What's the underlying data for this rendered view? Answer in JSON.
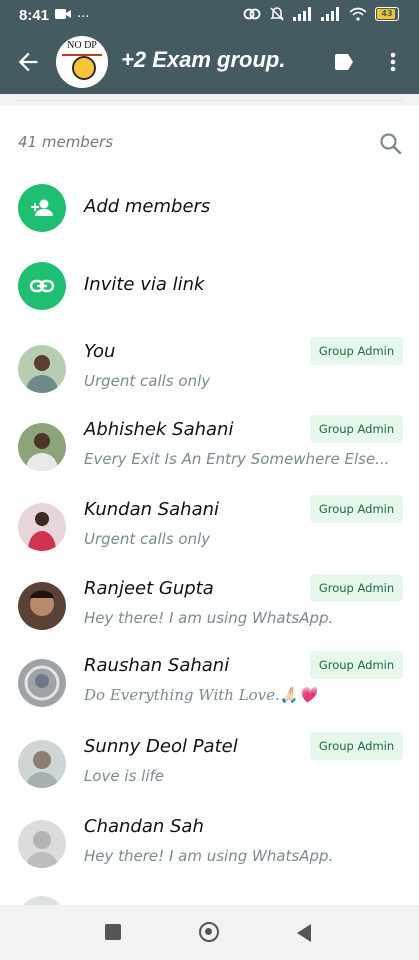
{
  "status_bar": {
    "time": "8:41",
    "battery": "43",
    "signal": "..."
  },
  "app_bar": {
    "title": "+2 Exam group.",
    "avatar_text": "NO DP",
    "bg_color": "#455b62"
  },
  "members_header": {
    "count_label": "41 members"
  },
  "actions": [
    {
      "label": "Add members",
      "icon": "person-add-icon"
    },
    {
      "label": "Invite via link",
      "icon": "link-icon"
    }
  ],
  "members": [
    {
      "name": "You",
      "status": "Urgent calls only",
      "badge": "Group Admin",
      "avatar_color": "#7aa37a"
    },
    {
      "name": "Abhishek Sahani",
      "status": "Every Exit Is An Entry Somewhere Else...",
      "badge": "Group Admin",
      "avatar_color": "#6f8a5a"
    },
    {
      "name": "Kundan Sahani",
      "status": "Urgent calls only",
      "badge": "Group Admin",
      "avatar_color": "#c2536a"
    },
    {
      "name": "Ranjeet Gupta",
      "status": "Hey there! I am using WhatsApp.",
      "badge": "Group Admin",
      "avatar_color": "#6b4b3a"
    },
    {
      "name": "Raushan Sahani",
      "status": "Do Everything With Love.🙏🏻💗",
      "badge": "Group Admin",
      "avatar_color": "#8a8f96"
    },
    {
      "name": "Sunny Deol Patel",
      "status": "Love is life",
      "badge": "Group Admin",
      "avatar_color": "#b8bfbf"
    },
    {
      "name": "Chandan Sah",
      "status": "Hey there! I am using WhatsApp.",
      "badge": "",
      "avatar_color": "#c9c9c9"
    }
  ],
  "accent_color": "#1fbf71"
}
